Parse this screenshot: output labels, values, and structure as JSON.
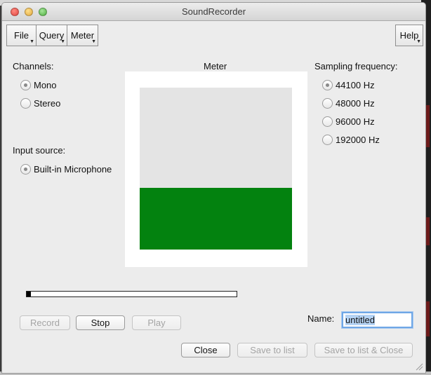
{
  "window": {
    "title": "SoundRecorder"
  },
  "menu": {
    "file": "File",
    "query": "Query",
    "meter": "Meter",
    "help": "Help"
  },
  "channels": {
    "label": "Channels:",
    "options": [
      "Mono",
      "Stereo"
    ],
    "selected": "Mono"
  },
  "input_source": {
    "label": "Input source:",
    "options": [
      "Built-in Microphone"
    ],
    "selected": "Built-in Microphone"
  },
  "meter": {
    "label": "Meter",
    "level": 0.38,
    "fill_color": "#03820f"
  },
  "sampling": {
    "label": "Sampling frequency:",
    "options": [
      "44100 Hz",
      "48000 Hz",
      "96000 Hz",
      "192000 Hz"
    ],
    "selected": "44100 Hz"
  },
  "progress": {
    "value": 0.02
  },
  "buttons": {
    "record": "Record",
    "stop": "Stop",
    "play": "Play",
    "close": "Close",
    "save_to_list": "Save to list",
    "save_to_list_close": "Save to list & Close"
  },
  "name_field": {
    "label": "Name:",
    "value": "untitled"
  }
}
